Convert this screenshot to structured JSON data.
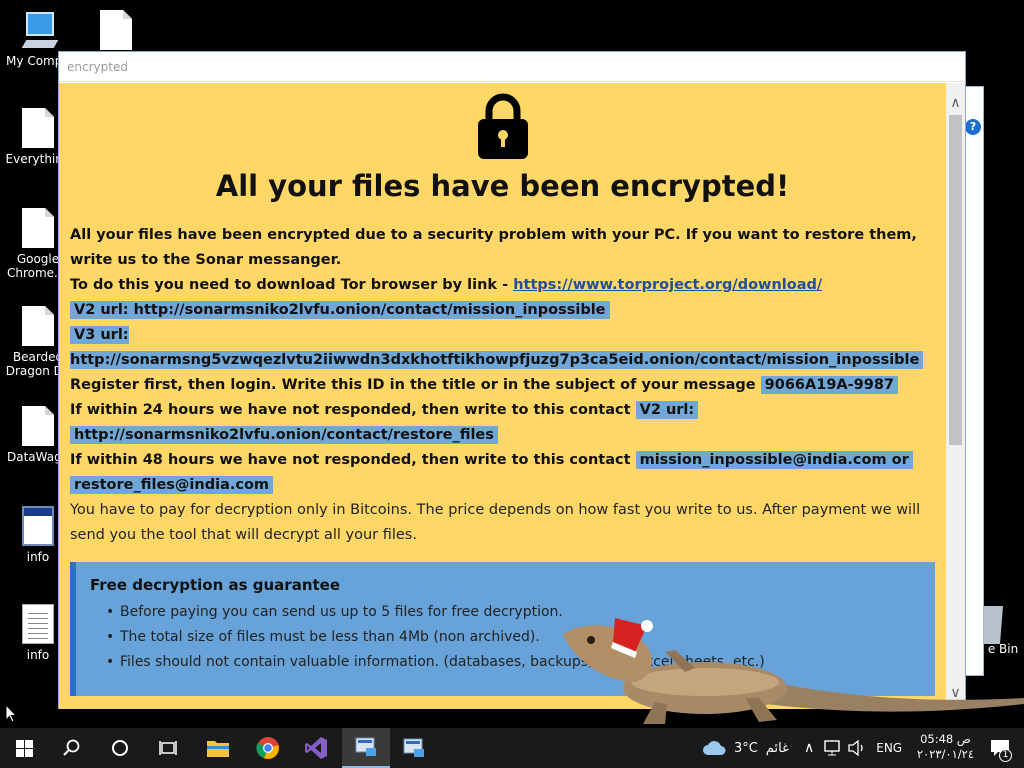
{
  "desktop": {
    "icons": [
      {
        "label": "My Compu",
        "icon": "computer-icon"
      },
      {
        "label": "",
        "icon": "file-icon"
      },
      {
        "label": "Everything",
        "icon": "file-icon"
      },
      {
        "label": "Google Chrome.In",
        "icon": "file-icon"
      },
      {
        "label": "Bearded Dragon De",
        "icon": "file-icon"
      },
      {
        "label": "DataWago",
        "icon": "file-icon"
      },
      {
        "label": "info",
        "icon": "window-icon"
      },
      {
        "label": "info",
        "icon": "text-file-icon"
      },
      {
        "label": "e Bin",
        "icon": "recycle-bin-icon"
      }
    ]
  },
  "window": {
    "title": "encrypted"
  },
  "note": {
    "heading": "All your files have been encrypted!",
    "intro": "All your files have been encrypted due to a security problem with your PC. If you want to restore them, write us to the Sonar messanger.",
    "tor_prefix": "To do this you need to download Tor browser by link - ",
    "tor_link": "https://www.torproject.org/download/",
    "v2_url": "V2 url: http://sonarmsniko2lvfu.onion/contact/mission_inpossible",
    "v3_url": "V3 url: http://sonarmsng5vzwqezlvtu2iiwwdn3dxkhotftikhowpfjuzg7p3ca5eid.onion/contact/mission_inpossible",
    "register_text": "Register first, then login. Write this ID in the title or in the subject of your message ",
    "id": "9066A19A-9987",
    "within24_text": "If within 24 hours we have not responded, then write to this contact ",
    "within24_contact_a": "V2 url:",
    "within24_contact_b": "http://sonarmsniko2lvfu.onion/contact/restore_files",
    "within48_text": "If within 48 hours we have not responded, then write to this contact ",
    "within48_contact_a": "mission_inpossible@india.com or",
    "within48_contact_b": "restore_files@india.com",
    "payment": "You have to pay for decryption only in Bitcoins. The price depends on how fast you write to us. After payment we will send you the tool that will decrypt all your files.",
    "guarantee": {
      "title": "Free decryption as guarantee",
      "items": [
        "Before paying you can send us up to 5 files for free decryption.",
        "The total size of files must be less than 4Mb (non archived).",
        "Files should not contain valuable information. (databases, backups, large excel sheets, etc.)"
      ]
    }
  },
  "taskbar": {
    "apps": [
      "start-icon",
      "search-icon",
      "cortana-icon",
      "task-view-icon",
      "file-explorer-icon",
      "chrome-icon",
      "visual-studio-icon",
      "installer-icon",
      "installer-icon"
    ],
    "weather_temp": "3°C",
    "weather_text": "غائم",
    "language": "ENG",
    "time": "05:48 ص",
    "date": "٢٠٢٣/٠١/٢٤",
    "notification_count": "1"
  }
}
